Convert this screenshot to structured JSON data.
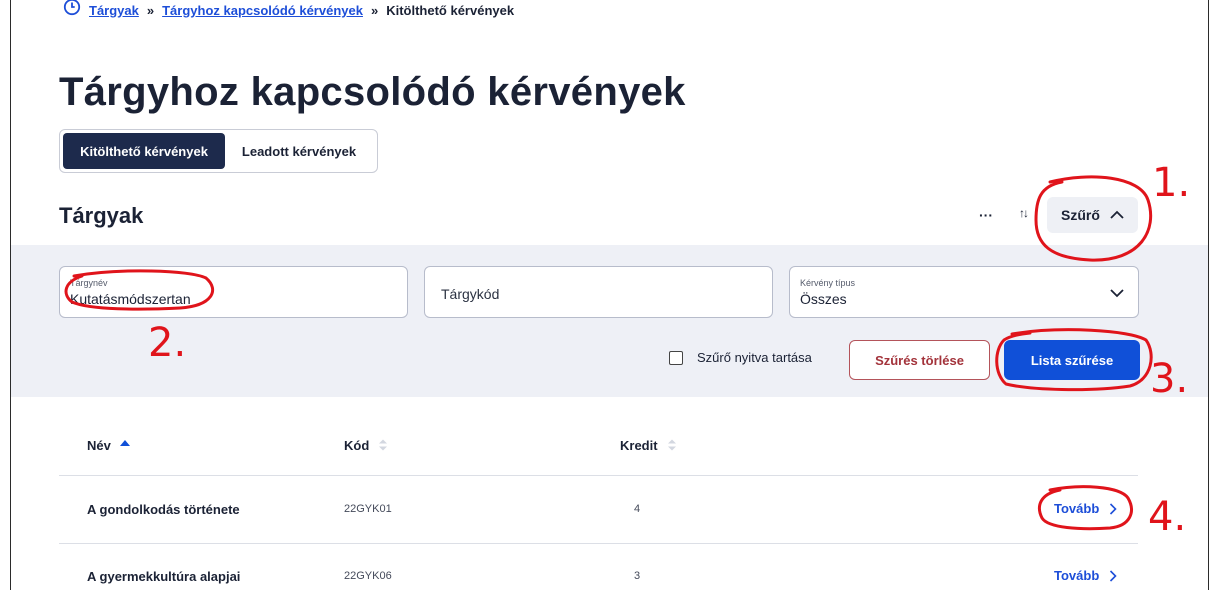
{
  "breadcrumb": {
    "items": [
      "Tárgyak",
      "Tárgyhoz kapcsolódó kérvények",
      "Kitölthető kérvények"
    ],
    "separator": "»"
  },
  "page": {
    "title": "Tárgyhoz kapcsolódó kérvények"
  },
  "tabs": [
    {
      "label": "Kitölthető kérvények",
      "active": true
    },
    {
      "label": "Leadott kérvények",
      "active": false
    }
  ],
  "section": {
    "title": "Tárgyak"
  },
  "toolbar": {
    "more_label": "···",
    "sort_label": "↑↓",
    "filter_label": "Szűrő"
  },
  "filters": {
    "subject_name": {
      "label": "Tárgynév",
      "value": "Kutatásmódszertan"
    },
    "subject_code": {
      "placeholder": "Tárgykód"
    },
    "request_type": {
      "label": "Kérvény típus",
      "value": "Összes"
    },
    "keep_open_label": "Szűrő nyitva tartása",
    "keep_open_checked": false,
    "clear_label": "Szűrés törlése",
    "apply_label": "Lista szűrése"
  },
  "table": {
    "columns": [
      "Név",
      "Kód",
      "Kredit"
    ],
    "sorted_column": "Név",
    "sort_direction": "asc",
    "rows": [
      {
        "name": "A gondolkodás története",
        "code": "22GYK01",
        "credit": "4",
        "action": "Tovább"
      },
      {
        "name": "A gyermekkultúra alapjai",
        "code": "22GYK06",
        "credit": "3",
        "action": "Tovább"
      }
    ]
  },
  "annotations": {
    "color": "#e0141b",
    "labels": [
      "1.",
      "2.",
      "3.",
      "4."
    ]
  },
  "colors": {
    "primary": "#1050d8",
    "link": "#1d4ed8",
    "tab_active": "#1d2a4c",
    "danger": "#a3333b",
    "panel_bg": "#eef0f6"
  }
}
